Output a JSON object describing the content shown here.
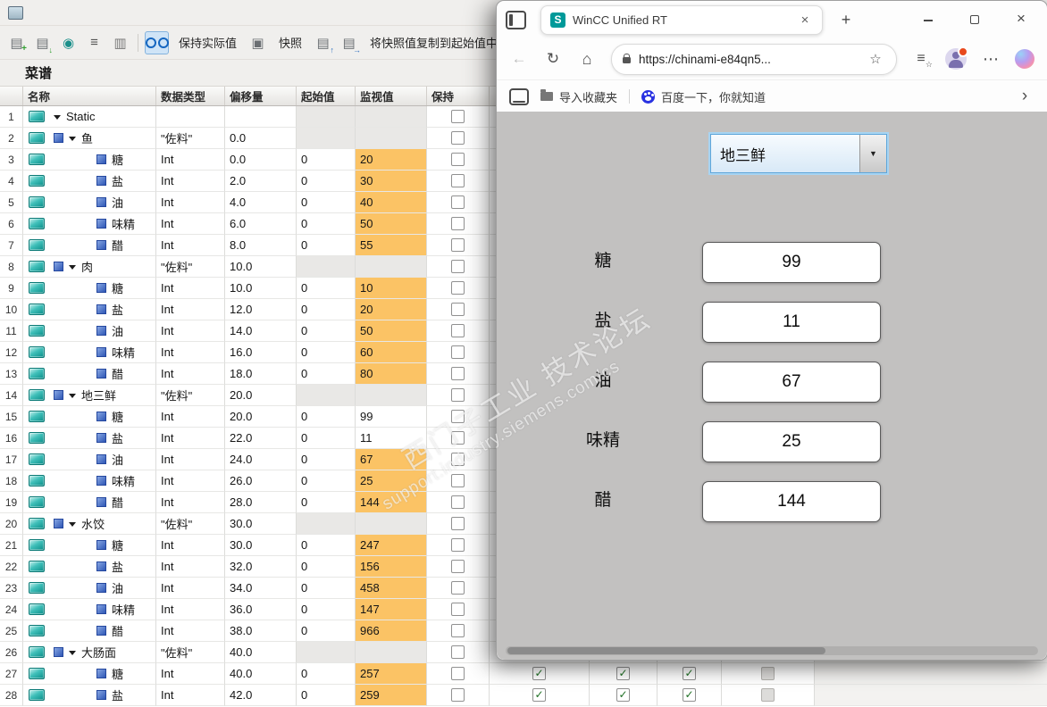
{
  "tia": {
    "title": "菜谱",
    "toolbar": {
      "keep_actual": "保持实际值",
      "snapshot": "快照",
      "copy_snapshot": "将快照值复制到起始值中"
    },
    "grid": {
      "headers": {
        "name": "名称",
        "datatype": "数据类型",
        "offset": "偏移量",
        "start": "起始值",
        "monitor": "监视值",
        "retain": "保持"
      },
      "rows": [
        {
          "n": 1,
          "kind": "root",
          "name": "Static",
          "dt": "",
          "off": "",
          "start": "",
          "mon": "",
          "hl": false
        },
        {
          "n": 2,
          "kind": "parent",
          "name": "鱼",
          "dt": "\"佐料\"",
          "off": "0.0",
          "start": "",
          "mon": "",
          "hl": false
        },
        {
          "n": 3,
          "kind": "child",
          "name": "糖",
          "dt": "Int",
          "off": "0.0",
          "start": "0",
          "mon": "20",
          "hl": true
        },
        {
          "n": 4,
          "kind": "child",
          "name": "盐",
          "dt": "Int",
          "off": "2.0",
          "start": "0",
          "mon": "30",
          "hl": true
        },
        {
          "n": 5,
          "kind": "child",
          "name": "油",
          "dt": "Int",
          "off": "4.0",
          "start": "0",
          "mon": "40",
          "hl": true
        },
        {
          "n": 6,
          "kind": "child",
          "name": "味精",
          "dt": "Int",
          "off": "6.0",
          "start": "0",
          "mon": "50",
          "hl": true
        },
        {
          "n": 7,
          "kind": "child",
          "name": "醋",
          "dt": "Int",
          "off": "8.0",
          "start": "0",
          "mon": "55",
          "hl": true
        },
        {
          "n": 8,
          "kind": "parent",
          "name": "肉",
          "dt": "\"佐料\"",
          "off": "10.0",
          "start": "",
          "mon": "",
          "hl": false
        },
        {
          "n": 9,
          "kind": "child",
          "name": "糖",
          "dt": "Int",
          "off": "10.0",
          "start": "0",
          "mon": "10",
          "hl": true
        },
        {
          "n": 10,
          "kind": "child",
          "name": "盐",
          "dt": "Int",
          "off": "12.0",
          "start": "0",
          "mon": "20",
          "hl": true
        },
        {
          "n": 11,
          "kind": "child",
          "name": "油",
          "dt": "Int",
          "off": "14.0",
          "start": "0",
          "mon": "50",
          "hl": true
        },
        {
          "n": 12,
          "kind": "child",
          "name": "味精",
          "dt": "Int",
          "off": "16.0",
          "start": "0",
          "mon": "60",
          "hl": true
        },
        {
          "n": 13,
          "kind": "child",
          "name": "醋",
          "dt": "Int",
          "off": "18.0",
          "start": "0",
          "mon": "80",
          "hl": true
        },
        {
          "n": 14,
          "kind": "parent",
          "name": "地三鲜",
          "dt": "\"佐料\"",
          "off": "20.0",
          "start": "",
          "mon": "",
          "hl": false
        },
        {
          "n": 15,
          "kind": "child",
          "name": "糖",
          "dt": "Int",
          "off": "20.0",
          "start": "0",
          "mon": "99",
          "hl": false
        },
        {
          "n": 16,
          "kind": "child",
          "name": "盐",
          "dt": "Int",
          "off": "22.0",
          "start": "0",
          "mon": "11",
          "hl": false
        },
        {
          "n": 17,
          "kind": "child",
          "name": "油",
          "dt": "Int",
          "off": "24.0",
          "start": "0",
          "mon": "67",
          "hl": true
        },
        {
          "n": 18,
          "kind": "child",
          "name": "味精",
          "dt": "Int",
          "off": "26.0",
          "start": "0",
          "mon": "25",
          "hl": true
        },
        {
          "n": 19,
          "kind": "child",
          "name": "醋",
          "dt": "Int",
          "off": "28.0",
          "start": "0",
          "mon": "144",
          "hl": true
        },
        {
          "n": 20,
          "kind": "parent",
          "name": "水饺",
          "dt": "\"佐料\"",
          "off": "30.0",
          "start": "",
          "mon": "",
          "hl": false
        },
        {
          "n": 21,
          "kind": "child",
          "name": "糖",
          "dt": "Int",
          "off": "30.0",
          "start": "0",
          "mon": "247",
          "hl": true
        },
        {
          "n": 22,
          "kind": "child",
          "name": "盐",
          "dt": "Int",
          "off": "32.0",
          "start": "0",
          "mon": "156",
          "hl": true
        },
        {
          "n": 23,
          "kind": "child",
          "name": "油",
          "dt": "Int",
          "off": "34.0",
          "start": "0",
          "mon": "458",
          "hl": true
        },
        {
          "n": 24,
          "kind": "child",
          "name": "味精",
          "dt": "Int",
          "off": "36.0",
          "start": "0",
          "mon": "147",
          "hl": true
        },
        {
          "n": 25,
          "kind": "child",
          "name": "醋",
          "dt": "Int",
          "off": "38.0",
          "start": "0",
          "mon": "966",
          "hl": true
        },
        {
          "n": 26,
          "kind": "parent",
          "name": "大肠面",
          "dt": "\"佐料\"",
          "off": "40.0",
          "start": "",
          "mon": "",
          "hl": false
        },
        {
          "n": 27,
          "kind": "child",
          "name": "糖",
          "dt": "Int",
          "off": "40.0",
          "start": "0",
          "mon": "257",
          "hl": true
        },
        {
          "n": 28,
          "kind": "child",
          "name": "盐",
          "dt": "Int",
          "off": "42.0",
          "start": "0",
          "mon": "259",
          "hl": true
        }
      ]
    }
  },
  "browser": {
    "tab_title": "WinCC Unified RT",
    "favicon_letter": "S",
    "url": "https://chinami-e84qn5...",
    "bookmarks": {
      "import": "导入收藏夹",
      "baidu": "百度一下，你就知道"
    },
    "page": {
      "recipe_selector": "地三鲜",
      "fields": [
        {
          "label": "糖",
          "value": "99"
        },
        {
          "label": "盐",
          "value": "11"
        },
        {
          "label": "油",
          "value": "67"
        },
        {
          "label": "味精",
          "value": "25"
        },
        {
          "label": "醋",
          "value": "144"
        }
      ]
    }
  },
  "watermark": {
    "line1": "西门子工业 技术论坛",
    "line2": "support.industry.siemens.com/cs"
  },
  "colors": {
    "monitor_highlight": "#fbc365",
    "siemens_teal": "#009999",
    "baidu_blue": "#2932e1",
    "page_gray": "#c2c1c0"
  }
}
